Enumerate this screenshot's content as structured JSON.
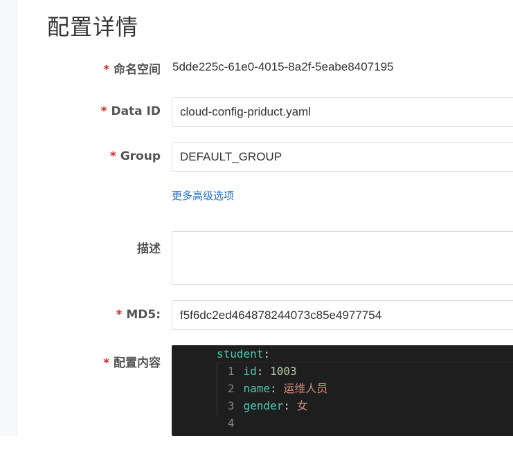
{
  "page_title": "配置详情",
  "required_mark": "*",
  "fields": {
    "namespace": {
      "label": "命名空间",
      "value": "5dde225c-61e0-4015-8a2f-5eabe8407195"
    },
    "data_id": {
      "label": "Data ID",
      "value": "cloud-config-priduct.yaml"
    },
    "group": {
      "label": "Group",
      "value": "DEFAULT_GROUP"
    },
    "advanced_link": "更多高级选项",
    "description": {
      "label": "描述",
      "value": ""
    },
    "md5": {
      "label": "MD5:",
      "value": "f5f6dc2ed464878244073c85e4977754"
    },
    "content": {
      "label": "配置内容"
    }
  },
  "editor": {
    "lines": [
      {
        "num": "1",
        "indent": "",
        "key": "student",
        "colon": ":",
        "value": "",
        "value_type": ""
      },
      {
        "num": "2",
        "indent": "    ",
        "key": "id",
        "colon": ":",
        "value": " 1003",
        "value_type": "number"
      },
      {
        "num": "3",
        "indent": "    ",
        "key": "name",
        "colon": ":",
        "value": " 运维人员",
        "value_type": "string"
      },
      {
        "num": "4",
        "indent": "    ",
        "key": "gender",
        "colon": ":",
        "value": " 女",
        "value_type": "string"
      }
    ],
    "colors": {
      "background": "#1e1e1e",
      "key": "#4ec9b0",
      "number": "#b5cea8",
      "string": "#ce9178",
      "line_number": "#858585"
    }
  },
  "colors": {
    "required": "#c7302b",
    "link": "#1e6fc1",
    "label": "#555555"
  }
}
